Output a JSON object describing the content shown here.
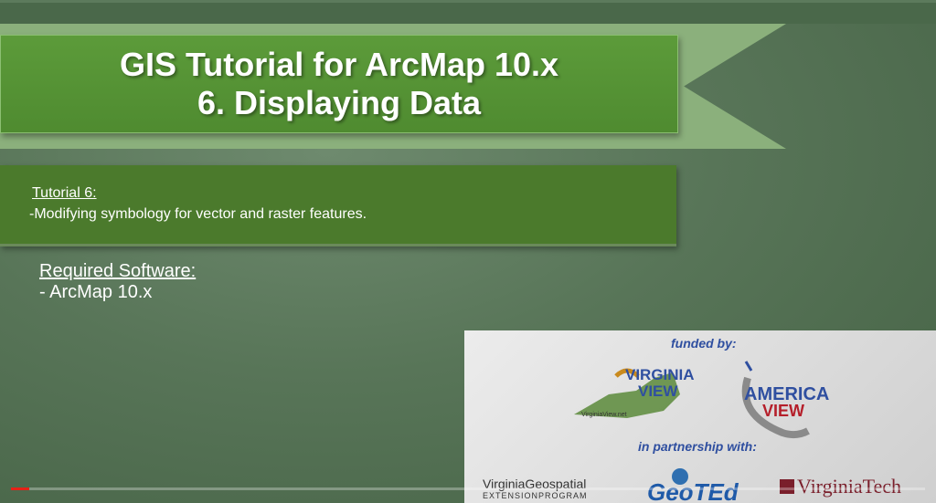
{
  "slide": {
    "title_line1": "GIS Tutorial for ArcMap 10.x",
    "title_line2": "6. Displaying Data",
    "tutorial_heading": "Tutorial 6:",
    "tutorial_text": "-Modifying symbology for vector and raster features.",
    "required_heading": "Required Software:",
    "required_item": "- ArcMap 10.x"
  },
  "sponsors": {
    "funded_by": "funded by:",
    "virginia_view_line1": "VIRGINIA",
    "virginia_view_line2": "VIEW",
    "virginia_view_url": "VirginiaView.net",
    "america_view_line1": "AMERICA",
    "america_view_line2": "VIEW",
    "partnership": "in partnership with:",
    "vge_name": "VirginiaGeospatial",
    "vge_sub": "EXTENSIONPROGRAM",
    "geoted": "GeoTEd",
    "vt": "VirginiaTech"
  },
  "video": {
    "progress": 0.02,
    "progress_color": "#e62117"
  },
  "colors": {
    "ribbon": "#5c9b3a",
    "desc_box": "#4b7a2c",
    "sponsor_text": "#2f4fa0"
  }
}
